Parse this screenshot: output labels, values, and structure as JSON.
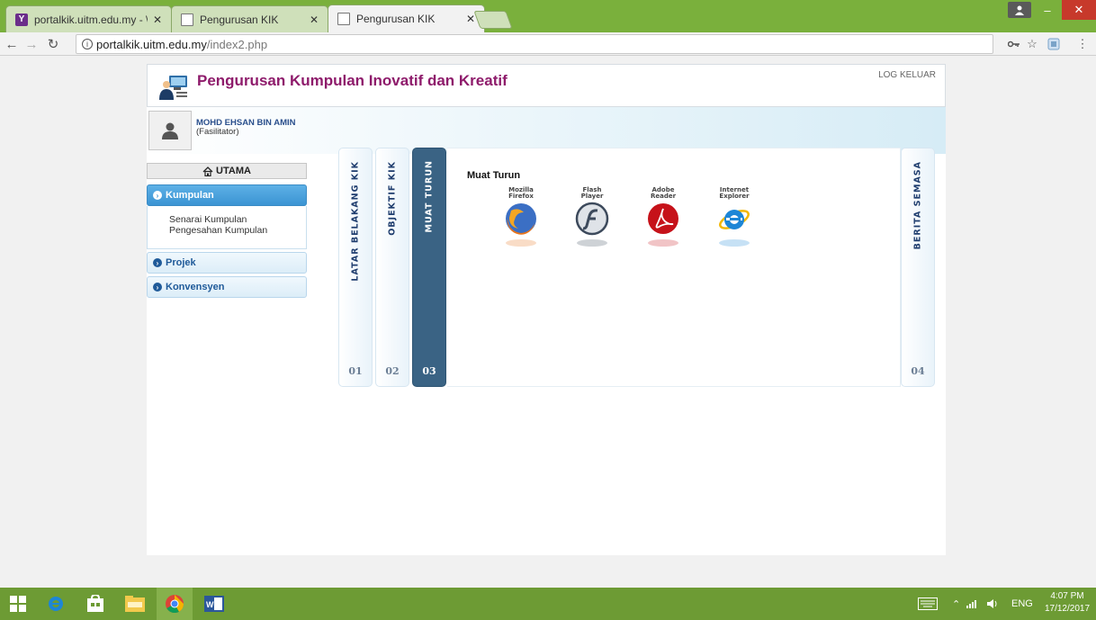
{
  "browser": {
    "tabs": [
      {
        "title": "portalkik.uitm.edu.my - \\",
        "favicon": "yahoo-icon",
        "active": false
      },
      {
        "title": "Pengurusan KIK",
        "favicon": "page-icon",
        "active": false
      },
      {
        "title": "Pengurusan KIK",
        "favicon": "page-icon",
        "active": true
      }
    ],
    "url_host": "portalkik.uitm.edu.my",
    "url_path": "/index2.php"
  },
  "header": {
    "title": "Pengurusan Kumpulan Inovatif dan Kreatif",
    "logout": "LOG KELUAR"
  },
  "user": {
    "name": "MOHD EHSAN BIN AMIN",
    "role": "(Fasilitator)"
  },
  "menu": {
    "home": "UTAMA",
    "sections": [
      {
        "label": "Kumpulan",
        "expanded": true,
        "items": [
          "Senarai Kumpulan",
          "Pengesahan Kumpulan"
        ]
      },
      {
        "label": "Projek",
        "expanded": false,
        "items": []
      },
      {
        "label": "Konvensyen",
        "expanded": false,
        "items": []
      }
    ]
  },
  "vtabs": [
    {
      "label": "LATAR BELAKANG KIK",
      "num": "01",
      "active": false
    },
    {
      "label": "OBJEKTIF KIK",
      "num": "02",
      "active": false
    },
    {
      "label": "MUAT TURUN",
      "num": "03",
      "active": true
    },
    {
      "label": "BERITA SEMASA",
      "num": "04",
      "active": false
    }
  ],
  "panel": {
    "title": "Muat Turun",
    "downloads": [
      {
        "line1": "Mozilla",
        "line2": "Firefox",
        "icon": "firefox-icon",
        "color": "#e8741a"
      },
      {
        "line1": "Flash",
        "line2": "Player",
        "icon": "flash-icon",
        "color": "#3d4a5c"
      },
      {
        "line1": "Adobe",
        "line2": "Reader",
        "icon": "adobe-reader-icon",
        "color": "#c6121a"
      },
      {
        "line1": "Internet",
        "line2": "Explorer",
        "icon": "ie-icon",
        "color": "#1d86d6"
      }
    ]
  },
  "taskbar": {
    "language": "ENG",
    "time": "4:07 PM",
    "date": "17/12/2017"
  }
}
